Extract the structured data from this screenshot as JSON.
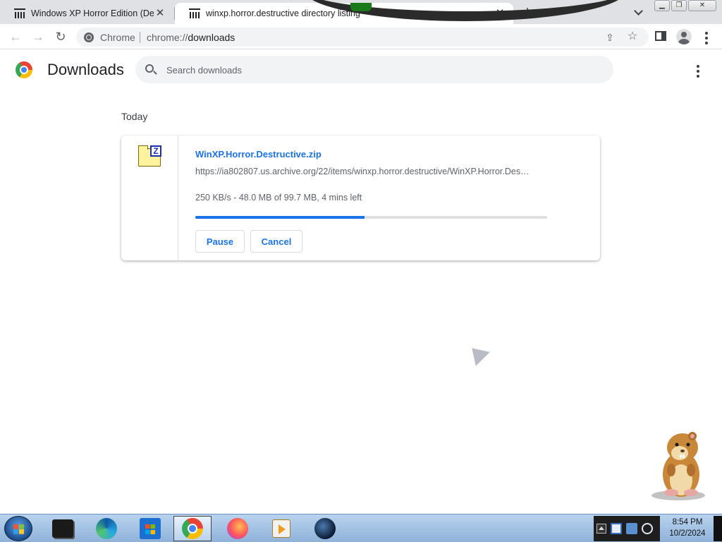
{
  "browser": {
    "tabs": [
      {
        "title": "Windows XP Horror Edition (Destructive)",
        "active": false
      },
      {
        "title": "winxp.horror.destructive directory listing",
        "active": true
      }
    ],
    "omnibox": {
      "chip_label": "Chrome",
      "url_scheme": "chrome://",
      "url_path": "downloads"
    }
  },
  "page": {
    "title": "Downloads",
    "search": {
      "placeholder": "Search downloads",
      "value": ""
    },
    "section_date": "Today",
    "download": {
      "file_name": "WinXP.Horror.Destructive.zip",
      "url": "https://ia802807.us.archive.org/22/items/winxp.horror.destructive/WinXP.Horror.Des…",
      "status": "250 KB/s - 48.0 MB of 99.7 MB, 4 mins left",
      "progress_fraction": 0.481,
      "pause_label": "Pause",
      "cancel_label": "Cancel"
    }
  },
  "taskbar": {
    "apps": [
      "terminal",
      "edge",
      "microsoft-store",
      "chrome",
      "firefox",
      "media-player",
      "dark-globe"
    ],
    "active_app": "chrome",
    "clock_time": "8:54 PM",
    "clock_date": "10/2/2024"
  },
  "colors": {
    "accent": "#1a73e8",
    "taskbar": "#b9d3ee"
  }
}
